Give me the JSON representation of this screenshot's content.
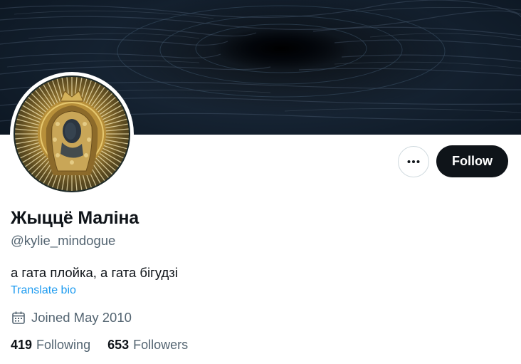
{
  "profile": {
    "display_name": "Жыццё Маліна",
    "handle": "@kylie_mindogue",
    "bio": "а гата плойка, а гата бігудзі",
    "translate_label": "Translate bio",
    "joined": "Joined May 2010",
    "following_count": "419",
    "following_label": "Following",
    "followers_count": "653",
    "followers_label": "Followers"
  },
  "actions": {
    "follow_label": "Follow",
    "more_icon": "more-horizontal-icon"
  },
  "icons": {
    "joined": "calendar-icon"
  },
  "colors": {
    "text_primary": "#0f1419",
    "text_secondary": "#536471",
    "link": "#1d9bf0",
    "follow_button_bg": "#0f1419",
    "border": "#cfd9de"
  }
}
